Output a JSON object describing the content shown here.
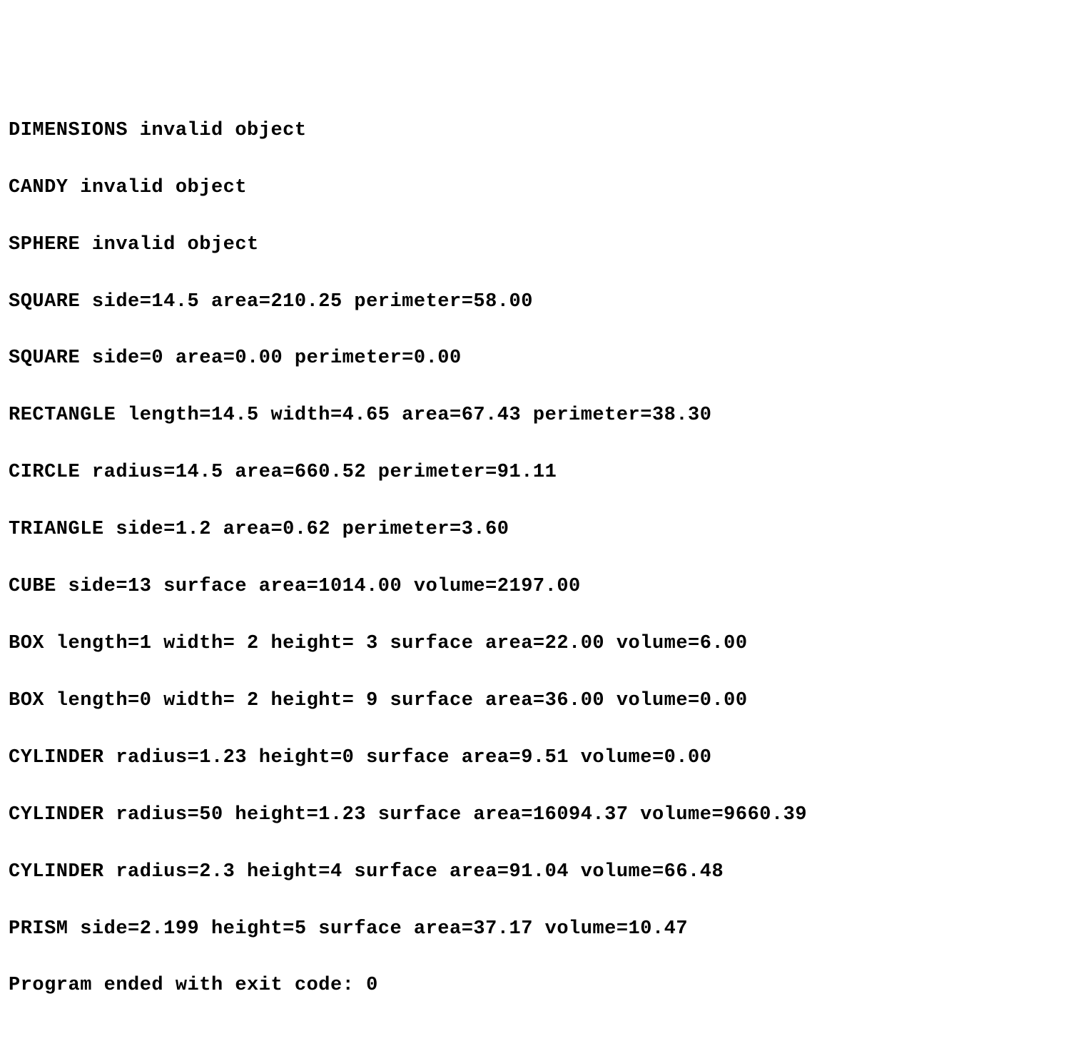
{
  "lines": [
    "DIMENSIONS invalid object",
    "CANDY invalid object",
    "SPHERE invalid object",
    "SQUARE side=14.5 area=210.25 perimeter=58.00",
    "SQUARE side=0 area=0.00 perimeter=0.00",
    "RECTANGLE length=14.5 width=4.65 area=67.43 perimeter=38.30",
    "CIRCLE radius=14.5 area=660.52 perimeter=91.11",
    "TRIANGLE side=1.2 area=0.62 perimeter=3.60",
    "CUBE side=13 surface area=1014.00 volume=2197.00",
    "BOX length=1 width= 2 height= 3 surface area=22.00 volume=6.00",
    "BOX length=0 width= 2 height= 9 surface area=36.00 volume=0.00",
    "CYLINDER radius=1.23 height=0 surface area=9.51 volume=0.00",
    "CYLINDER radius=50 height=1.23 surface area=16094.37 volume=9660.39",
    "CYLINDER radius=2.3 height=4 surface area=91.04 volume=66.48",
    "PRISM side=2.199 height=5 surface area=37.17 volume=10.47",
    "Program ended with exit code: 0"
  ]
}
